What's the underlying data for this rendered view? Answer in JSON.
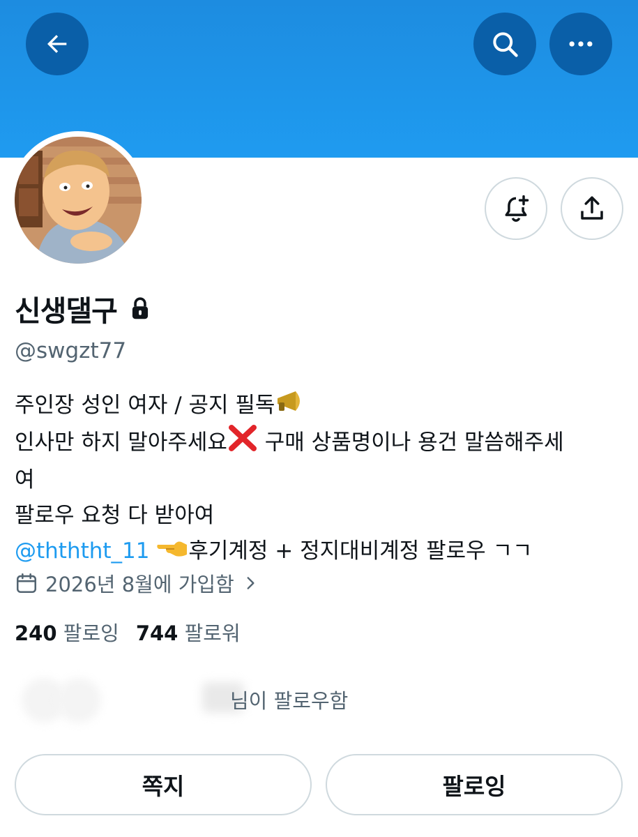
{
  "header": {
    "back_icon": "arrow-left-icon",
    "search_icon": "search-icon",
    "more_icon": "more-horizontal-icon",
    "banner_color": "#1d9bf0",
    "button_color": "#0a5fa8"
  },
  "profile": {
    "display_name": "신생댈구",
    "lock_icon": "lock-icon",
    "handle": "@swgzt77",
    "notify_icon": "bell-plus-icon",
    "share_icon": "share-icon"
  },
  "bio": {
    "line1": "주인장 성인 여자 / 공지 필독",
    "line1_emoji": "megaphone",
    "line2a": "인사만 하지 말아주세요",
    "line2_emoji": "cross-mark",
    "line2b": " 구매 상품명이나 용건 말씀해주세",
    "line3": "여",
    "line4": "팔로우 요청 다 받아여",
    "mention": "@thththt_11",
    "line5_emoji": "pointing-left-hand",
    "line5_text": "후기계정 + 정지대비계정 팔로우 ㄱㄱ"
  },
  "joined": {
    "icon": "calendar-icon",
    "text": "2026년 8월에 가입함",
    "chevron": "chevron-right-icon"
  },
  "stats": {
    "following_count": "240",
    "following_label": "팔로잉",
    "followers_count": "744",
    "followers_label": "팔로워"
  },
  "followed_by": {
    "text": "님이 팔로우함"
  },
  "actions": {
    "message_label": "쪽지",
    "following_label": "팔로잉"
  }
}
